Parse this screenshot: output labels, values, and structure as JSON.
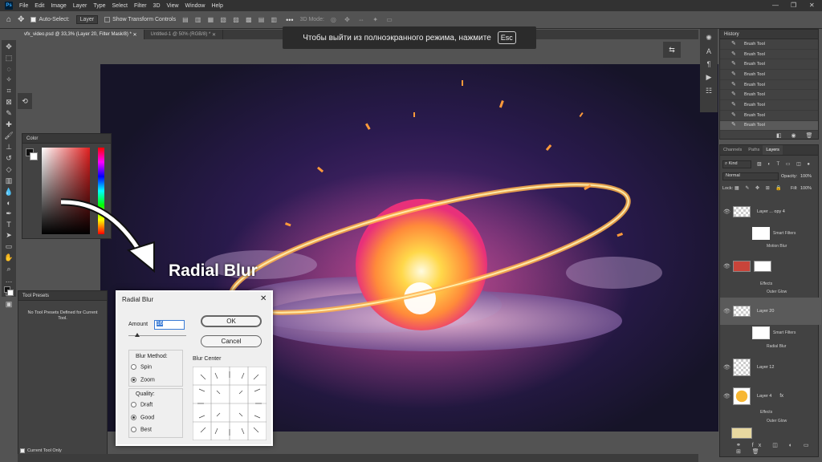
{
  "app": {
    "menu": [
      "File",
      "Edit",
      "Image",
      "Layer",
      "Type",
      "Select",
      "Filter",
      "3D",
      "View",
      "Window",
      "Help"
    ],
    "window_controls": [
      "—",
      "❐",
      "✕"
    ]
  },
  "options_bar": {
    "auto_select": "Auto-Select:",
    "layer_dropdown": "Layer",
    "show_transform": "Show Transform Controls",
    "mode_3d": "3D Mode:"
  },
  "tabs": [
    {
      "label": "vfx_video.psd @ 33,3% (Layer 20, Filter Mask/8) *"
    },
    {
      "label": "Untitled-1 @ 50% (RGB/8) *"
    }
  ],
  "toast": {
    "text": "Чтобы выйти из полноэкранного режима, нажмите",
    "key": "Esc"
  },
  "overlay_label": "Radial Blur",
  "color_panel": {
    "title": "Color"
  },
  "tool_presets": {
    "title": "Tool Presets",
    "empty": "No Tool Presets Defined for Current Tool.",
    "current_only": "Current Tool Only"
  },
  "radial_blur_dialog": {
    "title": "Radial Blur",
    "amount_label": "Amount",
    "amount_value": "16",
    "ok": "OK",
    "cancel": "Cancel",
    "blur_method_label": "Blur Method:",
    "methods": [
      "Spin",
      "Zoom"
    ],
    "selected_method": "Zoom",
    "quality_label": "Quality:",
    "qualities": [
      "Draft",
      "Good",
      "Best"
    ],
    "selected_quality": "Good",
    "blur_center_label": "Blur Center"
  },
  "history": {
    "title": "History",
    "items": [
      "Brush Tool",
      "Brush Tool",
      "Brush Tool",
      "Brush Tool",
      "Brush Tool",
      "Brush Tool",
      "Brush Tool",
      "Brush Tool",
      "Brush Tool"
    ]
  },
  "layers_panel": {
    "tabs": [
      "Channels",
      "Paths",
      "Layers"
    ],
    "active_tab": "Layers",
    "kind": "Kind",
    "blend_mode": "Normal",
    "opacity_label": "Opacity:",
    "opacity_value": "100%",
    "lock_label": "Lock:",
    "fill_label": "Fill:",
    "fill_value": "100%",
    "layers": [
      {
        "name": "Layer ... opy 4",
        "sub": [
          "Smart Filters",
          "Motion Blur"
        ]
      },
      {
        "name": "",
        "sub": [
          "Effects",
          "Outer Glow"
        ]
      },
      {
        "name": "Layer 20",
        "sub": [
          "Smart Filters",
          "Radial Blur"
        ]
      },
      {
        "name": "Layer 12",
        "sub": []
      },
      {
        "name": "Layer 4",
        "sub": [
          "Effects",
          "Outer Glow"
        ]
      }
    ]
  },
  "colors": {
    "accent": "#31a8ff",
    "canvas_bg": "#2a1a4e",
    "orb": "#ffb14a"
  }
}
